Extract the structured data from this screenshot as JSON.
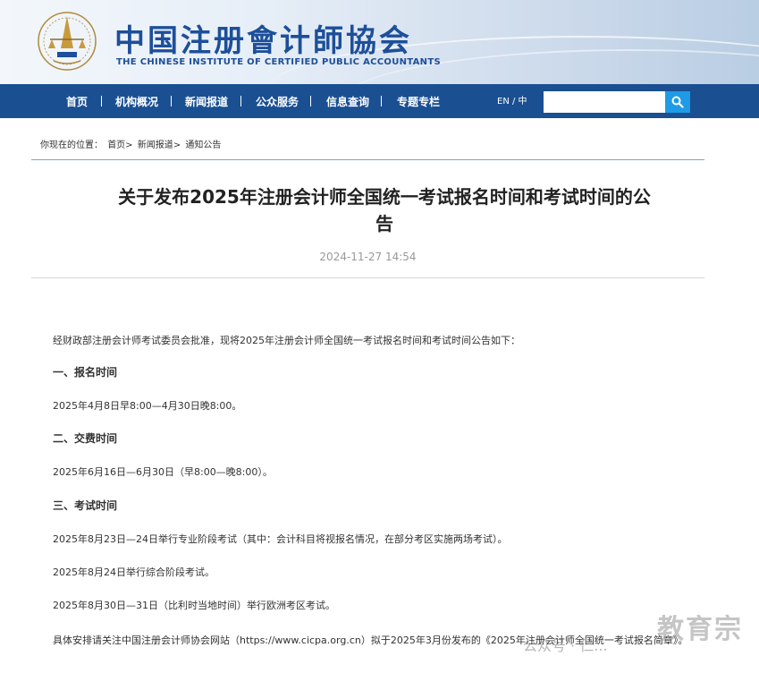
{
  "header": {
    "brand_cn": "中国注册會计師協会",
    "brand_en": "THE CHINESE INSTITUTE OF CERTIFIED PUBLIC ACCOUNTANTS"
  },
  "nav": {
    "items": [
      "首页",
      "机构概况",
      "新闻报道",
      "公众服务",
      "信息查询",
      "专题专栏"
    ],
    "lang": "EN / 中",
    "search_placeholder": ""
  },
  "breadcrumb": {
    "prefix": "你现在的位置：",
    "items": [
      "首页>",
      "新闻报道>",
      "通知公告"
    ]
  },
  "article": {
    "title": "关于发布2025年注册会计师全国统一考试报名时间和考试时间的公告",
    "date": "2024-11-27 14:54",
    "intro": "经财政部注册会计师考试委员会批准，现将2025年注册会计师全国统一考试报名时间和考试时间公告如下：",
    "sections": [
      {
        "heading": "一、报名时间",
        "lines": [
          "2025年4月8日早8:00—4月30日晚8:00。"
        ]
      },
      {
        "heading": "二、交费时间",
        "lines": [
          "2025年6月16日—6月30日（早8:00—晚8:00）。"
        ]
      },
      {
        "heading": "三、考试时间",
        "lines": [
          "2025年8月23日—24日举行专业阶段考试（其中：会计科目将视报名情况，在部分考区实施两场考试）。",
          "2025年8月24日举行综合阶段考试。",
          "2025年8月30日—31日（比利时当地时间）举行欧洲考区考试。"
        ]
      }
    ],
    "closing": "具体安排请关注中国注册会计师协会网站（https://www.cicpa.org.cn）拟于2025年3月份发布的《2025年注册会计师全国统一考试报名简章》。"
  },
  "watermark": {
    "main": "教育宗",
    "small": "公众号 · 仁..."
  },
  "colors": {
    "nav_bg": "#1a4f92",
    "brand": "#1d4f9a",
    "search_btn": "#1e9be6"
  }
}
